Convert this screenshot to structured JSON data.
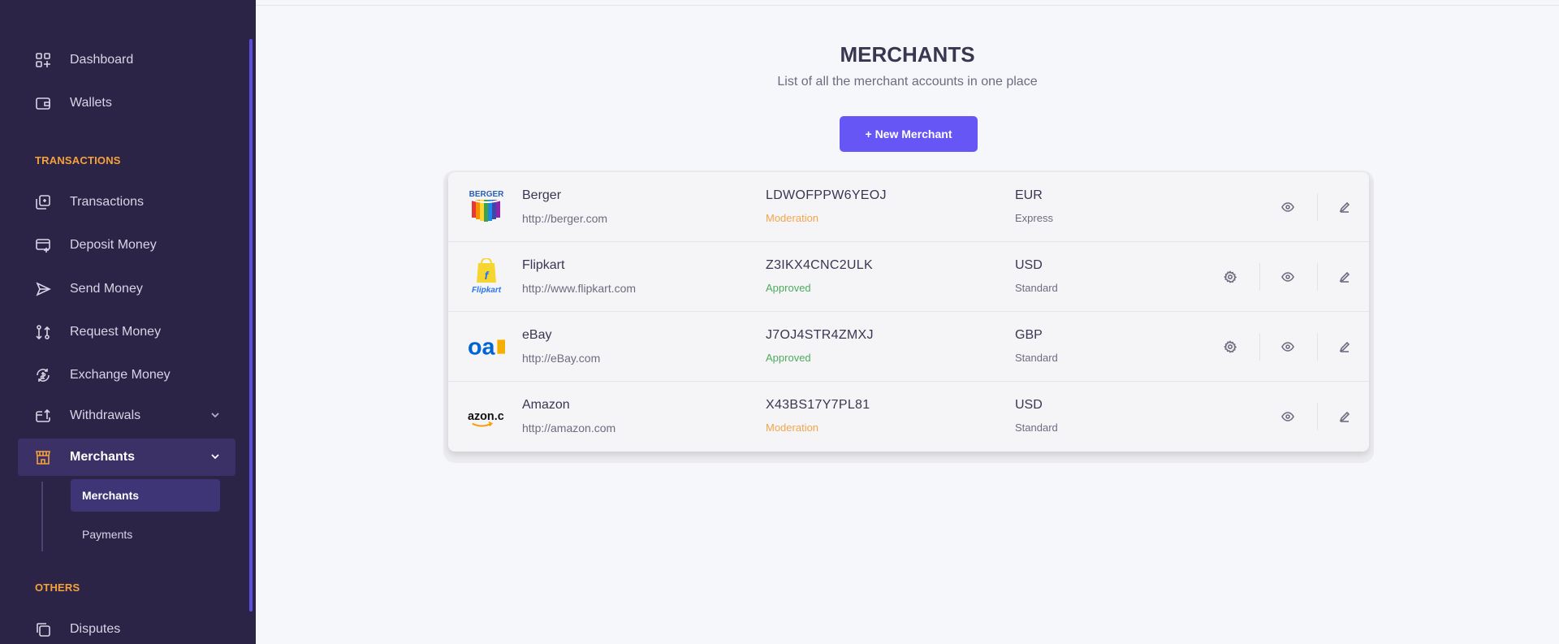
{
  "sidebar": {
    "items": [
      {
        "label": "Dashboard",
        "icon": "dashboard-icon"
      },
      {
        "label": "Wallets",
        "icon": "wallet-icon"
      }
    ],
    "sections": [
      {
        "title": "TRANSACTIONS",
        "items": [
          {
            "label": "Transactions",
            "icon": "transactions-icon"
          },
          {
            "label": "Deposit Money",
            "icon": "deposit-icon"
          },
          {
            "label": "Send Money",
            "icon": "send-icon"
          },
          {
            "label": "Request Money",
            "icon": "request-icon"
          },
          {
            "label": "Exchange Money",
            "icon": "exchange-icon"
          },
          {
            "label": "Withdrawals",
            "icon": "withdraw-icon",
            "expandable": true
          },
          {
            "label": "Merchants",
            "icon": "store-icon",
            "expandable": true,
            "active": true,
            "submenu": [
              {
                "label": "Merchants",
                "active": true
              },
              {
                "label": "Payments"
              }
            ]
          }
        ]
      },
      {
        "title": "OTHERS",
        "items": [
          {
            "label": "Disputes",
            "icon": "disputes-icon"
          }
        ]
      }
    ]
  },
  "main": {
    "title": "MERCHANTS",
    "subtitle": "List of all the merchant accounts in one place",
    "new_button_label": "+ New Merchant",
    "merchants": [
      {
        "name": "Berger",
        "url": "http://berger.com",
        "code": "LDWOFPPW6YEOJ",
        "status": "Moderation",
        "currency": "EUR",
        "plan": "Express",
        "logo": "berger-logo",
        "has_settings": false
      },
      {
        "name": "Flipkart",
        "url": "http://www.flipkart.com",
        "code": "Z3IKX4CNC2ULK",
        "status": "Approved",
        "currency": "USD",
        "plan": "Standard",
        "logo": "flipkart-logo",
        "has_settings": true
      },
      {
        "name": "eBay",
        "url": "http://eBay.com",
        "code": "J7OJ4STR4ZMXJ",
        "status": "Approved",
        "currency": "GBP",
        "plan": "Standard",
        "logo": "ebay-logo",
        "has_settings": true
      },
      {
        "name": "Amazon",
        "url": "http://amazon.com",
        "code": "X43BS17Y7PL81",
        "status": "Moderation",
        "currency": "USD",
        "plan": "Standard",
        "logo": "amazon-logo",
        "has_settings": false
      }
    ],
    "logo_text": {
      "berger": "BERGER",
      "flipkart": "Flipkart",
      "ebay": "oa",
      "amazon": "azon.c"
    }
  },
  "colors": {
    "sidebar_bg": "#2b2446",
    "accent": "#6656f5",
    "section_label": "#f6a23b",
    "moderation": "#f3a54a",
    "approved": "#4eaa5c"
  }
}
